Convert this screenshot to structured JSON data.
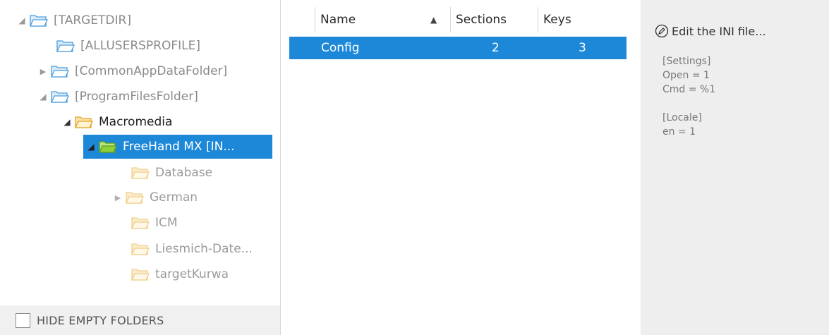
{
  "tree": {
    "items": [
      {
        "label": "[TARGETDIR]",
        "expander": "open",
        "folder": "blue"
      },
      {
        "label": "[ALLUSERSPROFILE]",
        "expander": "none",
        "folder": "blue"
      },
      {
        "label": "[CommonAppDataFolder]",
        "expander": "closed",
        "folder": "blue"
      },
      {
        "label": "[ProgramFilesFolder]",
        "expander": "open",
        "folder": "blue"
      },
      {
        "label": "Macromedia",
        "expander": "open",
        "folder": "yellow"
      },
      {
        "label": "FreeHand MX [IN...",
        "expander": "open",
        "folder": "green",
        "selected": true
      },
      {
        "label": "Database",
        "expander": "none",
        "folder": "pale"
      },
      {
        "label": "German",
        "expander": "closed",
        "folder": "pale"
      },
      {
        "label": "ICM",
        "expander": "none",
        "folder": "pale"
      },
      {
        "label": "Liesmich-Date...",
        "expander": "none",
        "folder": "pale"
      },
      {
        "label": "targetKurwa",
        "expander": "none",
        "folder": "pale"
      }
    ],
    "hide_empty_label": "HIDE EMPTY FOLDERS"
  },
  "table": {
    "columns": [
      "Name",
      "Sections",
      "Keys"
    ],
    "sort_column": "Name",
    "sort_arrow": "▲",
    "rows": [
      {
        "name": "Config",
        "sections": "2",
        "keys": "3",
        "selected": true
      }
    ]
  },
  "ini": {
    "edit_label": "Edit the INI file...",
    "content": "[Settings]\nOpen = 1\nCmd = %1\n\n[Locale]\nen = 1"
  },
  "colors": {
    "selection": "#1e88d8",
    "folder_blue": "#4a9ee0",
    "folder_yellow": "#f2b233",
    "folder_green": "#7cc431",
    "folder_pale": "#f4d591"
  }
}
